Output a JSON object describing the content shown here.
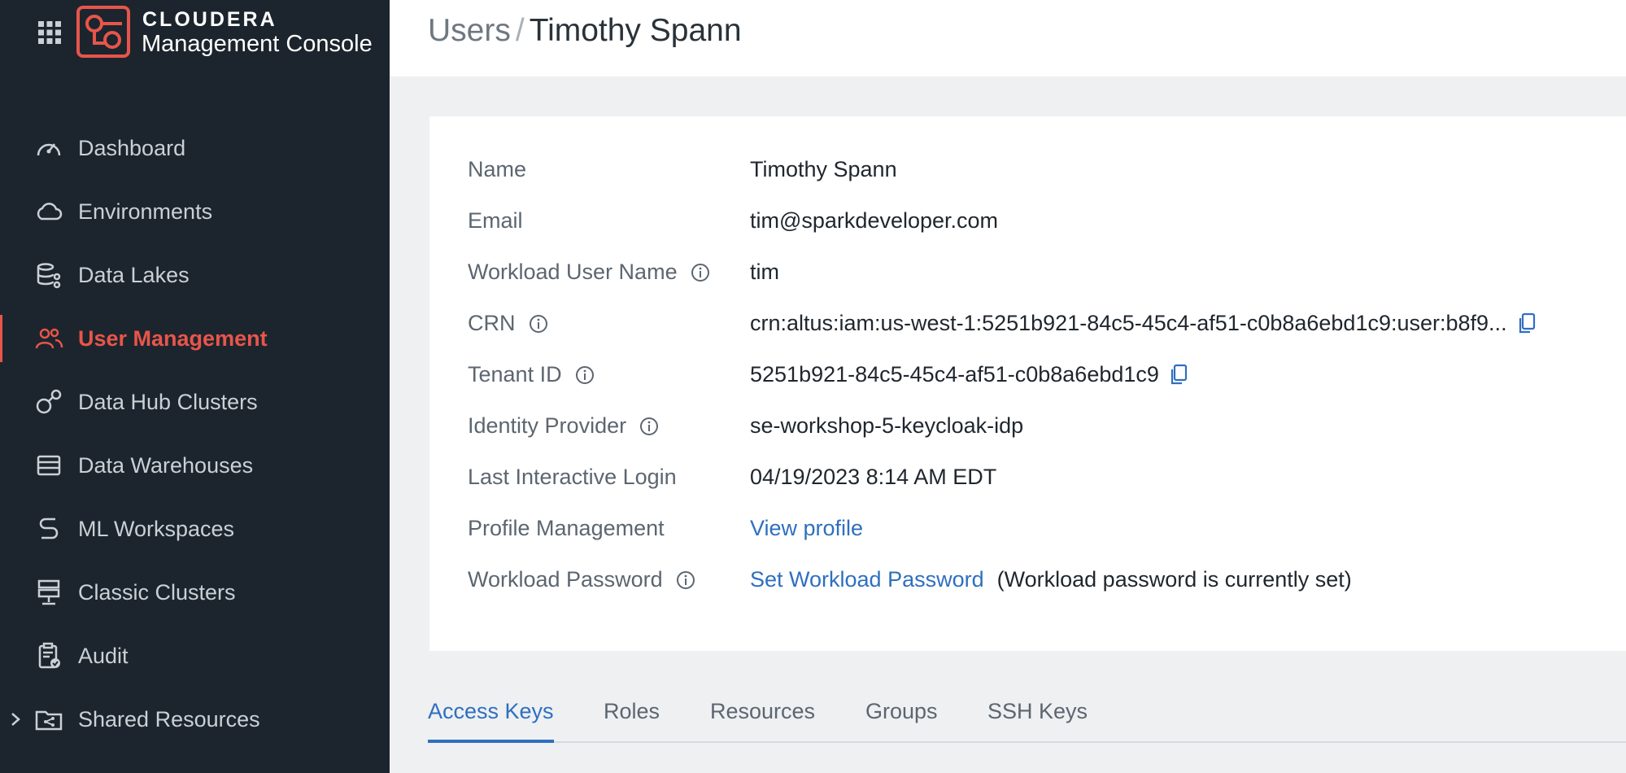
{
  "brand": {
    "name": "CLOUDERA",
    "product": "Management Console",
    "accent_color": "#e8554b"
  },
  "sidebar": {
    "items": [
      {
        "label": "Dashboard",
        "icon": "gauge-icon"
      },
      {
        "label": "Environments",
        "icon": "cloud-icon"
      },
      {
        "label": "Data Lakes",
        "icon": "data-lake-icon"
      },
      {
        "label": "User Management",
        "icon": "users-icon",
        "active": true
      },
      {
        "label": "Data Hub Clusters",
        "icon": "data-hub-icon"
      },
      {
        "label": "Data Warehouses",
        "icon": "warehouse-icon"
      },
      {
        "label": "ML Workspaces",
        "icon": "ml-icon"
      },
      {
        "label": "Classic Clusters",
        "icon": "classic-clusters-icon"
      },
      {
        "label": "Audit",
        "icon": "audit-icon"
      },
      {
        "label": "Shared Resources",
        "icon": "folder-share-icon",
        "expandable": true
      }
    ]
  },
  "header": {
    "breadcrumb_root": "Users",
    "separator": "/",
    "title": "Timothy Spann"
  },
  "details": {
    "name": {
      "label": "Name",
      "value": "Timothy Spann"
    },
    "email": {
      "label": "Email",
      "value": "tim@sparkdeveloper.com"
    },
    "workload_user": {
      "label": "Workload User Name",
      "value": "tim"
    },
    "crn": {
      "label": "CRN",
      "value": "crn:altus:iam:us-west-1:5251b921-84c5-45c4-af51-c0b8a6ebd1c9:user:b8f9..."
    },
    "tenant": {
      "label": "Tenant ID",
      "value": "5251b921-84c5-45c4-af51-c0b8a6ebd1c9"
    },
    "idp": {
      "label": "Identity Provider",
      "value": "se-workshop-5-keycloak-idp"
    },
    "last_login": {
      "label": "Last Interactive Login",
      "value": "04/19/2023 8:14 AM EDT"
    },
    "profile": {
      "label": "Profile Management",
      "link": "View profile"
    },
    "password": {
      "label": "Workload Password",
      "link": "Set Workload Password",
      "note": "(Workload password is currently set)"
    }
  },
  "tabs": [
    "Access Keys",
    "Roles",
    "Resources",
    "Groups",
    "SSH Keys"
  ],
  "active_tab": "Access Keys",
  "colors": {
    "link": "#2f6fbf",
    "sidebar_bg": "#1c252d"
  }
}
